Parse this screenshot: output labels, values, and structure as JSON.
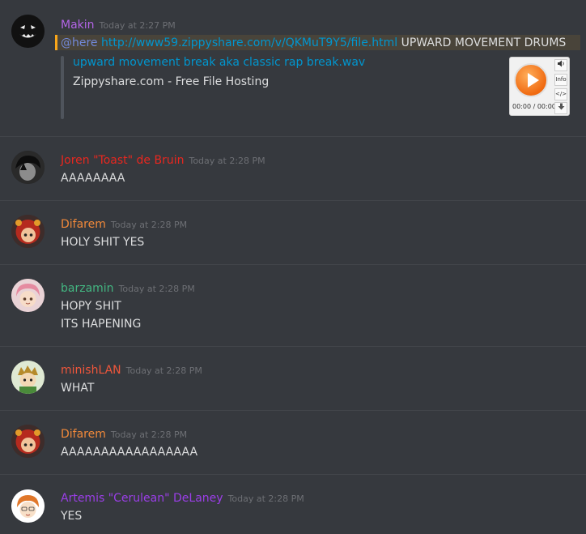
{
  "timestamp_prefix": "Today at",
  "messages": [
    {
      "username": "Makin",
      "color": "#b364e6",
      "time": "Today at 2:27 PM",
      "mention": "@here",
      "link": "http://www59.zippyshare.com/v/QKMuT9Y5/file.html",
      "text_after": " UPWARD MOVEMENT DRUMS",
      "embed": {
        "title": "upward movement break aka classic rap break.wav",
        "description": "Zippyshare.com - Free File Hosting",
        "player_time": "00:00 / 00:00",
        "player_buttons": [
          "volume-icon",
          "Info",
          "</>",
          "download-icon"
        ]
      }
    },
    {
      "username": "Joren \"Toast\" de Bruin",
      "color": "#e8271f",
      "time": "Today at 2:28 PM",
      "lines": [
        "AAAAAAAA"
      ]
    },
    {
      "username": "Difarem",
      "color": "#f1893a",
      "time": "Today at 2:28 PM",
      "lines": [
        "HOLY SHIT YES"
      ]
    },
    {
      "username": "barzamin",
      "color": "#43b581",
      "time": "Today at 2:28 PM",
      "lines": [
        "HOPY SHIT",
        "ITS HAPENING"
      ]
    },
    {
      "username": "minishLAN",
      "color": "#f0563b",
      "time": "Today at 2:28 PM",
      "lines": [
        "WHAT"
      ]
    },
    {
      "username": "Difarem",
      "color": "#f1893a",
      "time": "Today at 2:28 PM",
      "lines": [
        "AAAAAAAAAAAAAAAAA"
      ]
    },
    {
      "username": "Artemis \"Cerulean\" DeLaney",
      "color": "#9b3ee8",
      "time": "Today at 2:28 PM",
      "lines": [
        "YES"
      ]
    }
  ]
}
